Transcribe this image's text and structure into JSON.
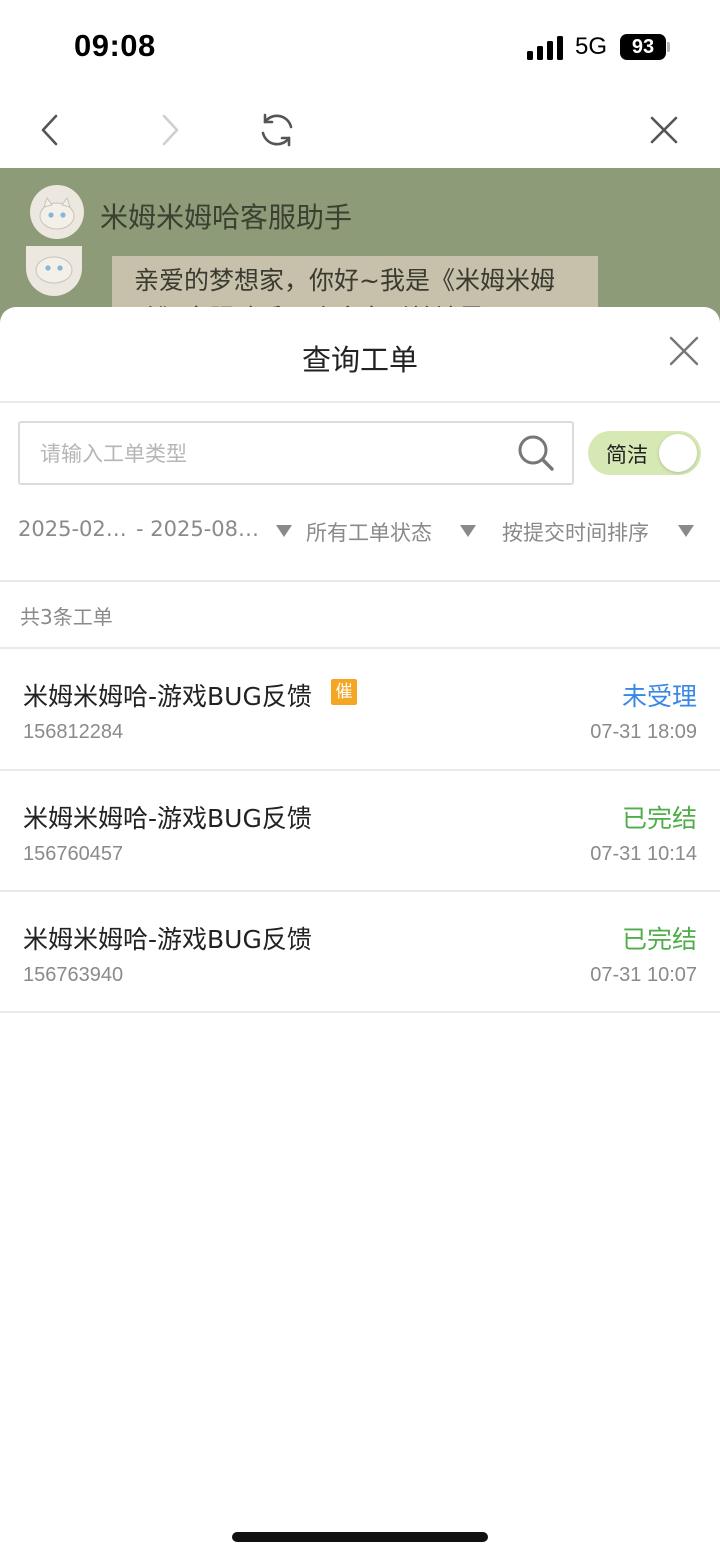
{
  "status_bar": {
    "time": "09:08",
    "network": "5G",
    "battery": "93"
  },
  "chat": {
    "title": "米姆米姆哈客服助手",
    "message": "亲爱的梦想家，你好~我是《米姆米姆哈》客服助手，欢迎来到禁地界！"
  },
  "sheet": {
    "title": "查询工单",
    "search": {
      "placeholder": "请输入工单类型",
      "value": ""
    },
    "toggle_label": "简洁",
    "filters": {
      "date_start": "2025-02…",
      "date_end": "- 2025-08…",
      "status": "所有工单状态",
      "sort": "按提交时间排序"
    },
    "count_text": "共3条工单",
    "tickets": [
      {
        "title": "米姆米姆哈-游戏BUG反馈",
        "badge": "催",
        "status": "未受理",
        "status_color": "#3a88e6",
        "id": "156812284",
        "time": "07-31 18:09"
      },
      {
        "title": "米姆米姆哈-游戏BUG反馈",
        "badge": "",
        "status": "已完结",
        "status_color": "#4fae4a",
        "id": "156760457",
        "time": "07-31 10:14"
      },
      {
        "title": "米姆米姆哈-游戏BUG反馈",
        "badge": "",
        "status": "已完结",
        "status_color": "#4fae4a",
        "id": "156763940",
        "time": "07-31 10:07"
      }
    ]
  },
  "colors": {
    "accent_green": "#4fae4a",
    "pending_blue": "#3a88e6",
    "urge_orange": "#f5a623",
    "toggle_bg": "#d6e8b4"
  }
}
